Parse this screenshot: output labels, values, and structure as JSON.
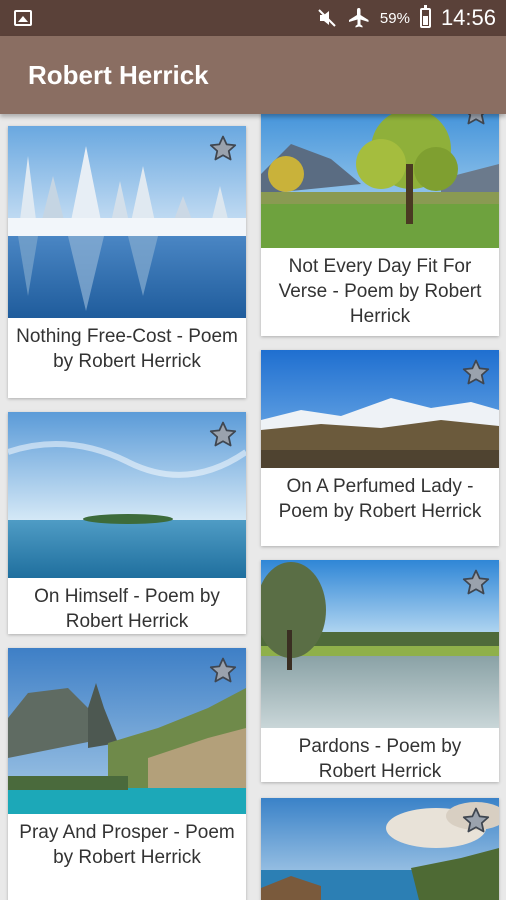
{
  "status_bar": {
    "battery_percent": "59%",
    "time": "14:56",
    "icons": [
      "gallery-icon",
      "mute-icon",
      "airplane-icon",
      "battery-icon"
    ]
  },
  "app_bar": {
    "title": "Robert Herrick"
  },
  "poems": [
    {
      "title": "Nothing Free-Cost - Poem by Robert Herrick",
      "image": "snowy-forest-lake"
    },
    {
      "title": "Not Every Day Fit For Verse - Poem by Robert Herrick",
      "image": "green-tree-meadow"
    },
    {
      "title": "On Himself - Poem by Robert Herrick",
      "image": "sea-island"
    },
    {
      "title": "On A Perfumed Lady - Poem by Robert Herrick",
      "image": "snowy-mountains"
    },
    {
      "title": "Pray And Prosper - Poem by Robert Herrick",
      "image": "rocky-coast-bay"
    },
    {
      "title": "Pardons - Poem by Robert Herrick",
      "image": "frosty-field"
    },
    {
      "title": "",
      "image": "coastal-cliffs"
    }
  ],
  "colors": {
    "status_bar": "#5a4139",
    "app_bar": "#8a6e62",
    "star_fill": "#9aa2ad"
  }
}
